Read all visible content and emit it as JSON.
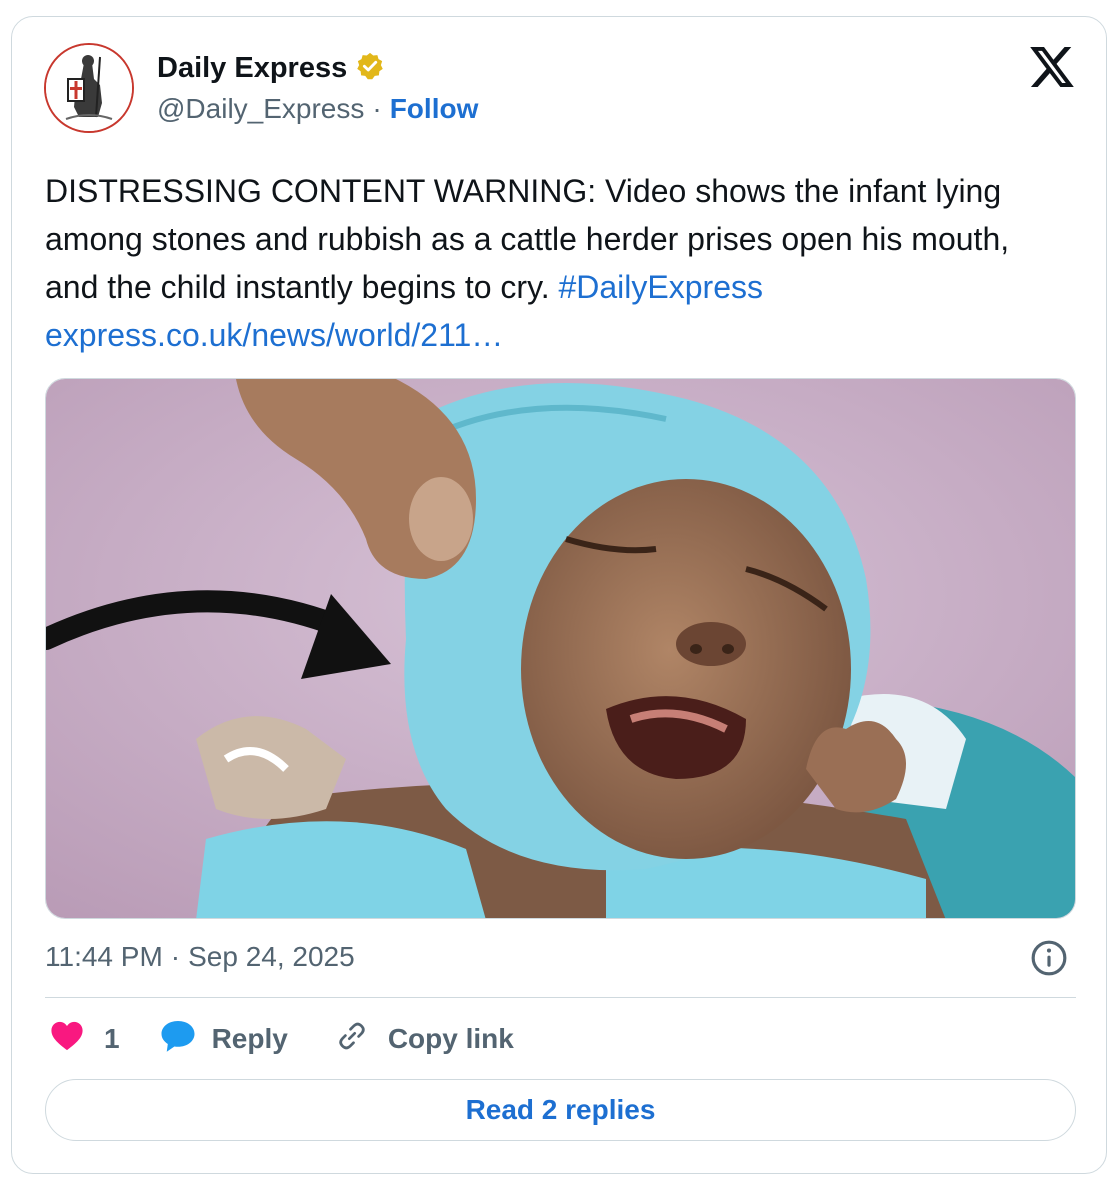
{
  "author": {
    "display_name": "Daily Express",
    "handle": "@Daily_Express",
    "separator": "·",
    "follow_label": "Follow",
    "verified_color": "#e2b719"
  },
  "tweet": {
    "text": "DISTRESSING CONTENT WARNING: Video shows the infant lying among stones and rubbish as a cattle herder prises open his mouth, and the child instantly begins to cry.",
    "hashtag": "#DailyExpress",
    "link": "express.co.uk/news/world/211…",
    "time": "11:44 PM",
    "date_separator": "·",
    "date": "Sep 24, 2025"
  },
  "actions": {
    "like_count": "1",
    "reply_label": "Reply",
    "copy_label": "Copy link",
    "read_replies_label": "Read 2 replies"
  },
  "colors": {
    "link": "#1d6fd1",
    "like": "#f91880",
    "reply_bubble": "#1d9bf0",
    "border": "#cfd9de"
  },
  "icons": [
    "x-logo-icon",
    "verified-badge-icon",
    "info-icon",
    "heart-icon",
    "reply-bubble-icon",
    "link-icon"
  ]
}
